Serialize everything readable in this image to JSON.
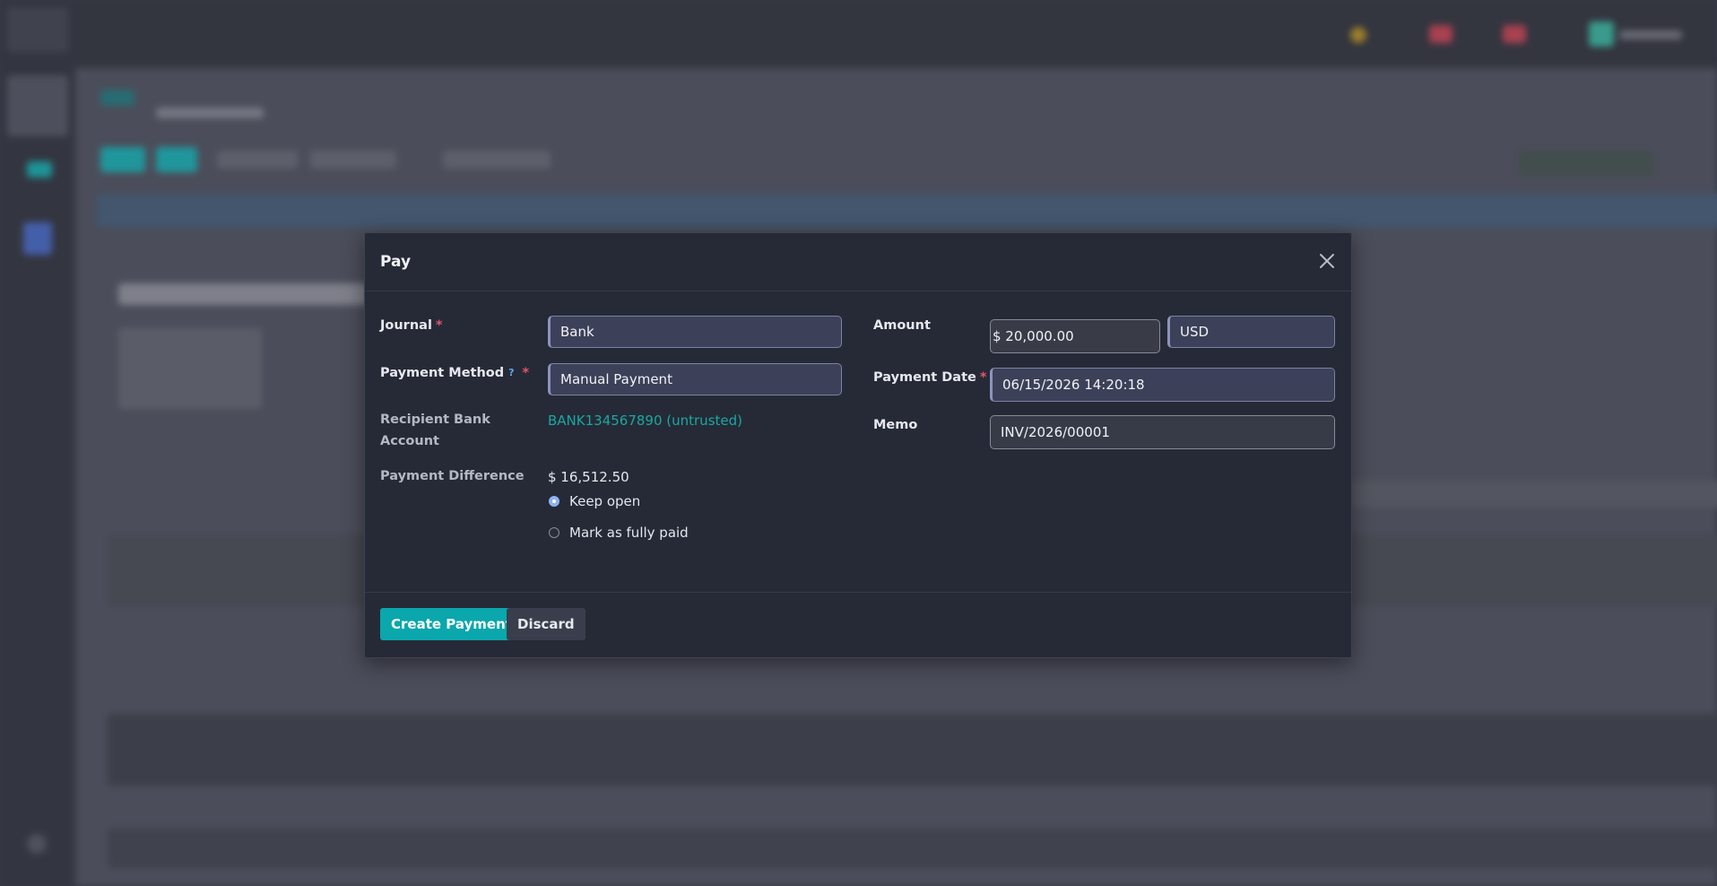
{
  "dialog": {
    "title": "Pay",
    "journal": {
      "label": "Journal",
      "required_mark": "*",
      "value": "Bank"
    },
    "payment_method": {
      "label": "Payment Method",
      "help_mark": "?",
      "required_mark": "*",
      "value": "Manual Payment"
    },
    "recipient_bank_account": {
      "label_line1": "Recipient Bank",
      "label_line2": "Account",
      "value": "BANK134567890 (untrusted)"
    },
    "payment_difference": {
      "label": "Payment Difference",
      "value": "$ 16,512.50",
      "options": [
        {
          "label": "Keep open",
          "selected": true
        },
        {
          "label": "Mark as fully paid",
          "selected": false
        }
      ]
    },
    "amount": {
      "label": "Amount",
      "value": "$ 20,000.00",
      "currency": "USD"
    },
    "payment_date": {
      "label": "Payment Date",
      "required_mark": "*",
      "value": "06/15/2026 14:20:18"
    },
    "memo": {
      "label": "Memo",
      "value": "INV/2026/00001"
    },
    "buttons": {
      "create": "Create Payment",
      "discard": "Discard"
    }
  },
  "colors": {
    "modal_bg": "#262a36",
    "primary": "#0aa7ad",
    "link": "#1aa7a4",
    "required": "#e0556b",
    "field_bg": "#3c4058"
  },
  "icons": {
    "close": "close-icon"
  }
}
